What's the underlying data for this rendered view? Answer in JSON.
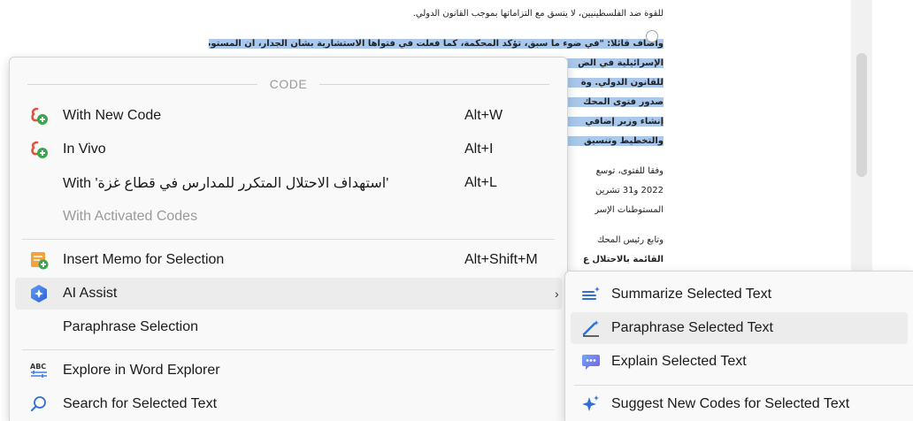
{
  "document": {
    "lines": [
      "للقوة ضد الفلسطينيين، لا يتسق مع التزاماتها بموجب القانون الدولي.",
      "وأضاف قائلا: \"في ضوء ما سبق، تؤكد المحكمة، كما فعلت في فتواها الاستشارية بشأن الجدار، أن المستوطنات",
      "الإسرائيلية في الض",
      "للقانون الدولي. وة",
      "صدور فتوى المحك",
      "إنشاء وزير إضافي",
      "والتخطيط وتنسيق",
      "وفقا للفتوى، توسع",
      "2022 و31 تشرين",
      "المستوطنات الإسر",
      "وتابع رئيس المحك",
      "القائمة بالاحتلال ع"
    ]
  },
  "main_menu": {
    "header": "CODE",
    "items": [
      {
        "label": "With New Code",
        "shortcut": "Alt+W",
        "icon": "new-code-icon"
      },
      {
        "label": "In Vivo",
        "shortcut": "Alt+I",
        "icon": "in-vivo-icon"
      },
      {
        "label": "With 'استهداف الاحتلال المتكرر للمدارس في قطاع غزة'",
        "shortcut": "Alt+L"
      },
      {
        "label": "With Activated Codes",
        "disabled": true
      },
      {
        "label": "Insert Memo for Selection",
        "shortcut": "Alt+Shift+M",
        "icon": "memo-icon"
      },
      {
        "label": "AI Assist",
        "icon": "ai-assist-icon",
        "arrow": "›"
      },
      {
        "label": "Paraphrase Selection"
      },
      {
        "label": "Explore in Word Explorer",
        "icon": "word-explorer-icon"
      },
      {
        "label": "Search for Selected Text",
        "icon": "search-icon"
      }
    ]
  },
  "sub_menu": {
    "items": [
      {
        "label": "Summarize Selected Text",
        "icon": "summarize-icon"
      },
      {
        "label": "Paraphrase Selected Text",
        "icon": "paraphrase-icon"
      },
      {
        "label": "Explain Selected Text",
        "icon": "explain-icon"
      },
      {
        "label": "Suggest New Codes for Selected Text",
        "icon": "suggest-codes-icon"
      }
    ]
  },
  "colors": {
    "highlight": "#a9c8ec",
    "code_icon_red": "#e0533f",
    "code_icon_green": "#3aa54a",
    "memo_orange": "#f2a33a",
    "ai_blue": "#3f7fe8",
    "accent_blue": "#2f6fd6"
  }
}
